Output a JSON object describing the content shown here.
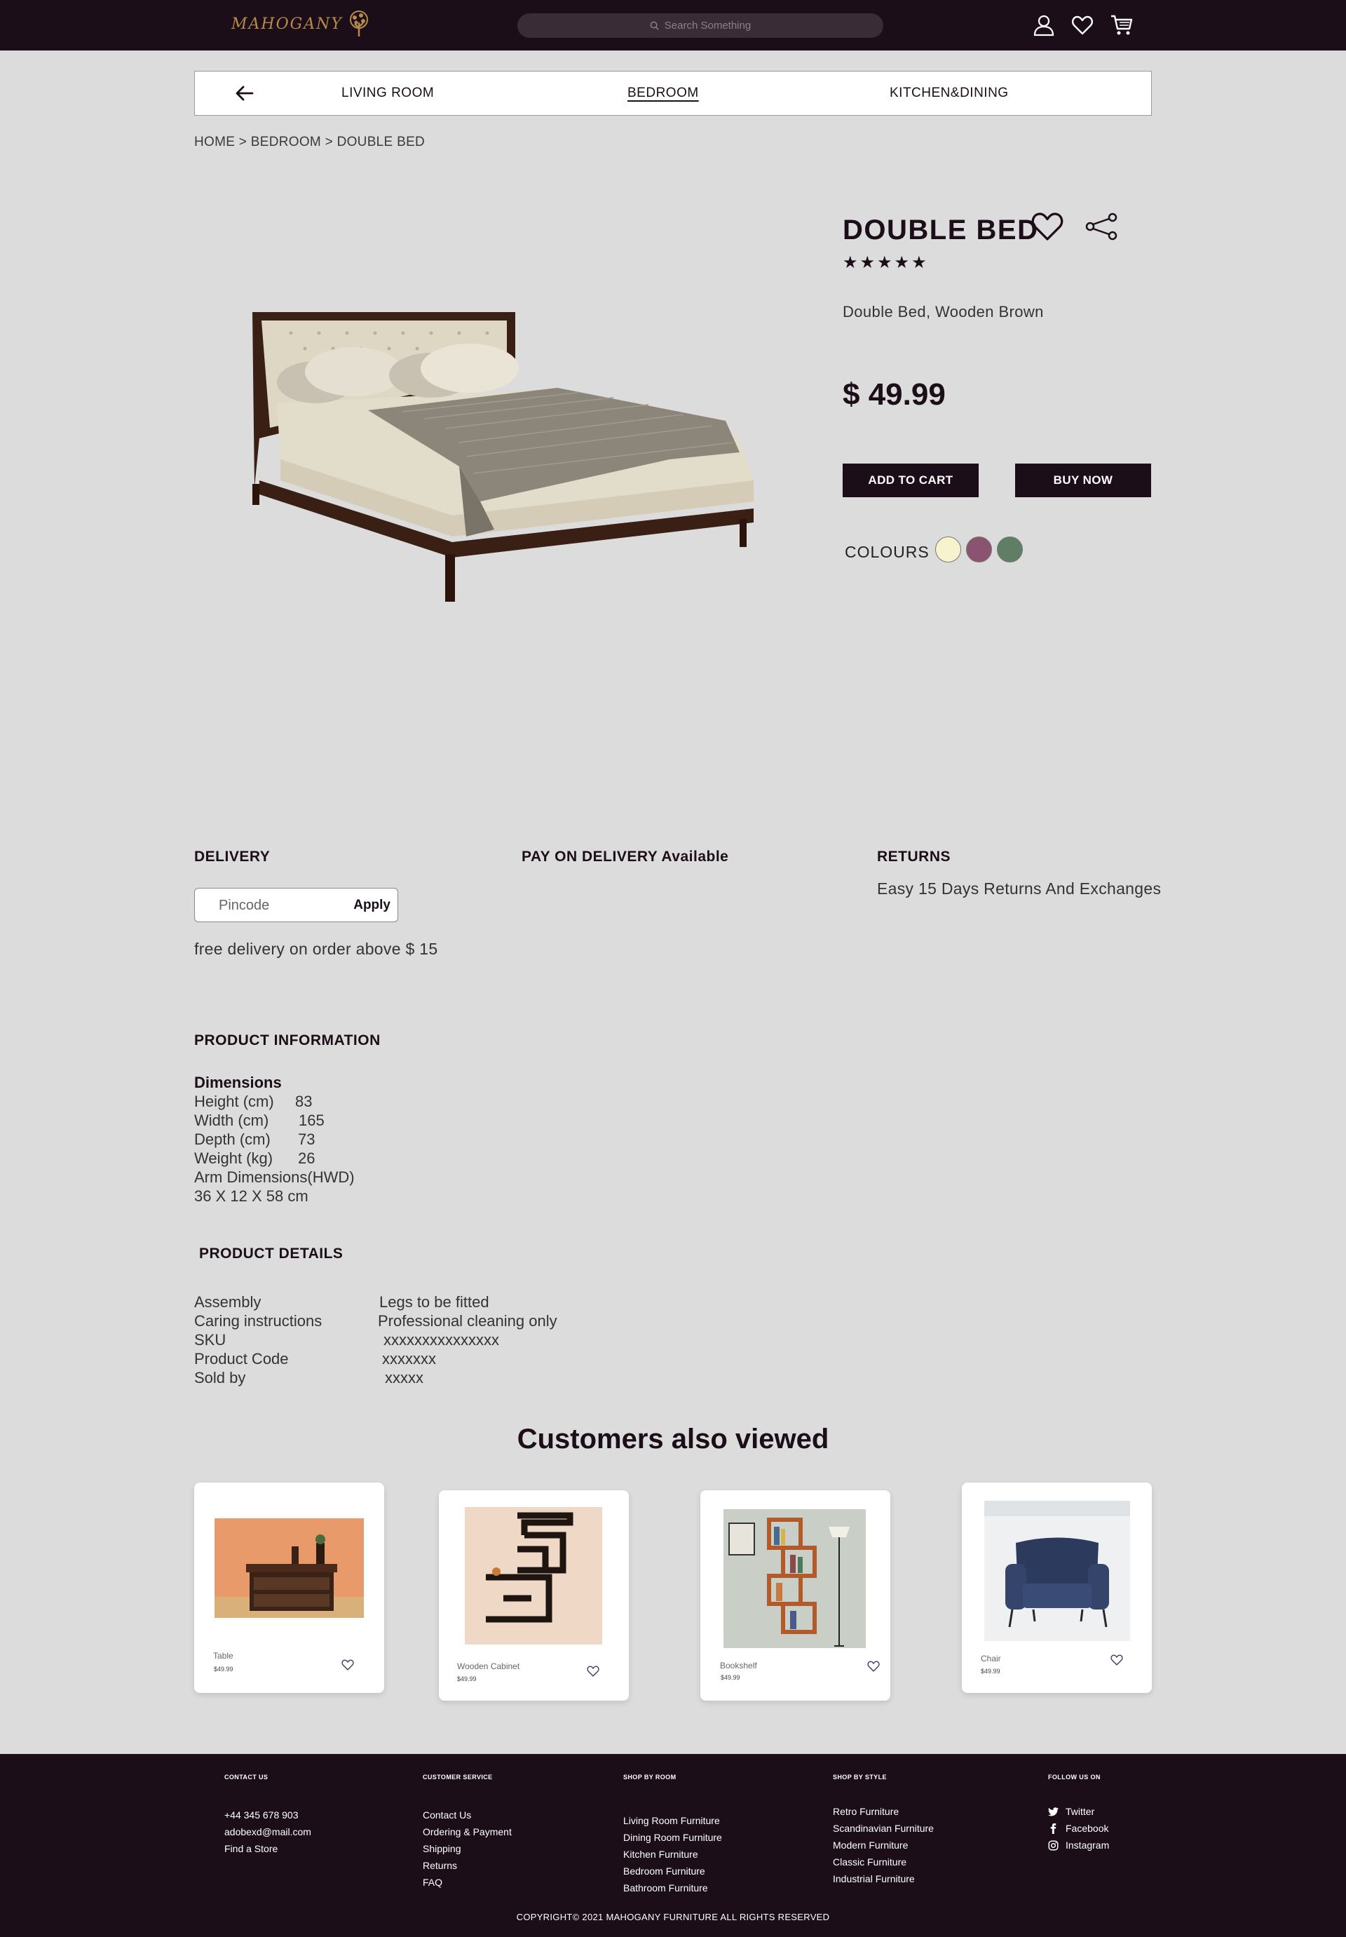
{
  "header": {
    "logo_text": "MAHOGANY",
    "search_placeholder": "Search Something",
    "icons": [
      "user-icon",
      "heart-icon",
      "cart-icon"
    ]
  },
  "category_nav": {
    "items": [
      "LIVING ROOM",
      "BEDROOM",
      "KITCHEN&DINING"
    ],
    "active": "BEDROOM"
  },
  "breadcrumb": "HOME > BEDROOM > DOUBLE BED",
  "product": {
    "title": "DOUBLE BED",
    "rating_stars": "★★★★★",
    "description": "Double Bed, Wooden Brown",
    "price": "$ 49.99",
    "add_to_cart": "ADD TO CART",
    "buy_now": "BUY NOW",
    "colours_label": "COLOURS",
    "colours": [
      "#f8f3cf",
      "#8a5470",
      "#5f7e63"
    ]
  },
  "delivery": {
    "heading": "DELIVERY",
    "pincode_placeholder": "Pincode",
    "apply_label": "Apply",
    "free_delivery": "free delivery on order above $ 15",
    "pay_on_delivery": "PAY ON DELIVERY Available",
    "returns_heading": "RETURNS",
    "returns_text": "Easy 15 Days Returns And Exchanges"
  },
  "product_information": {
    "heading": "PRODUCT INFORMATION",
    "dimensions_label": "Dimensions",
    "rows": [
      {
        "label": "Height (cm)",
        "value": "83"
      },
      {
        "label": "Width (cm)",
        "value": "165"
      },
      {
        "label": "Depth (cm)",
        "value": "73"
      },
      {
        "label": "Weight (kg)",
        "value": "26"
      }
    ],
    "arm_label": "Arm Dimensions(HWD)",
    "arm_value": "36 X 12 X 58 cm"
  },
  "product_details": {
    "heading": "PRODUCT DETAILS",
    "rows": [
      {
        "label": "Assembly",
        "value": "Legs to be fitted"
      },
      {
        "label": "Caring instructions",
        "value": "Professional cleaning only"
      },
      {
        "label": "SKU",
        "value": "xxxxxxxxxxxxxxx"
      },
      {
        "label": "Product Code",
        "value": "xxxxxxx"
      },
      {
        "label": "Sold by",
        "value": "xxxxx"
      }
    ]
  },
  "also_viewed": {
    "title": "Customers also viewed",
    "items": [
      {
        "name": "Table",
        "price": "$49.99"
      },
      {
        "name": "Wooden Cabinet",
        "price": "$49.99"
      },
      {
        "name": "Bookshelf",
        "price": "$49.99"
      },
      {
        "name": "Chair",
        "price": "$49.99"
      }
    ]
  },
  "footer": {
    "contact": {
      "heading": "CONTACT US",
      "items": [
        "+44 345 678 903",
        "adobexd@mail.com",
        "Find a Store"
      ]
    },
    "service": {
      "heading": "CUSTOMER SERVICE",
      "items": [
        "Contact Us",
        "Ordering & Payment",
        "Shipping",
        "Returns",
        "FAQ"
      ]
    },
    "room": {
      "heading": "SHOP BY ROOM",
      "items": [
        "Living Room Furniture",
        "Dining Room Furniture",
        "Kitchen Furniture",
        "Bedroom Furniture",
        "Bathroom Furniture"
      ]
    },
    "style": {
      "heading": "SHOP BY STYLE",
      "items": [
        "Retro Furniture",
        "Scandinavian Furniture",
        "Modern Furniture",
        "Classic Furniture",
        "Industrial Furniture"
      ]
    },
    "follow": {
      "heading": "FOLLOW US ON",
      "items": [
        "Twitter",
        "Facebook",
        "Instagram"
      ]
    },
    "copyright": "COPYRIGHT© 2021 MAHOGANY FURNITURE ALL RIGHTS RESERVED"
  }
}
